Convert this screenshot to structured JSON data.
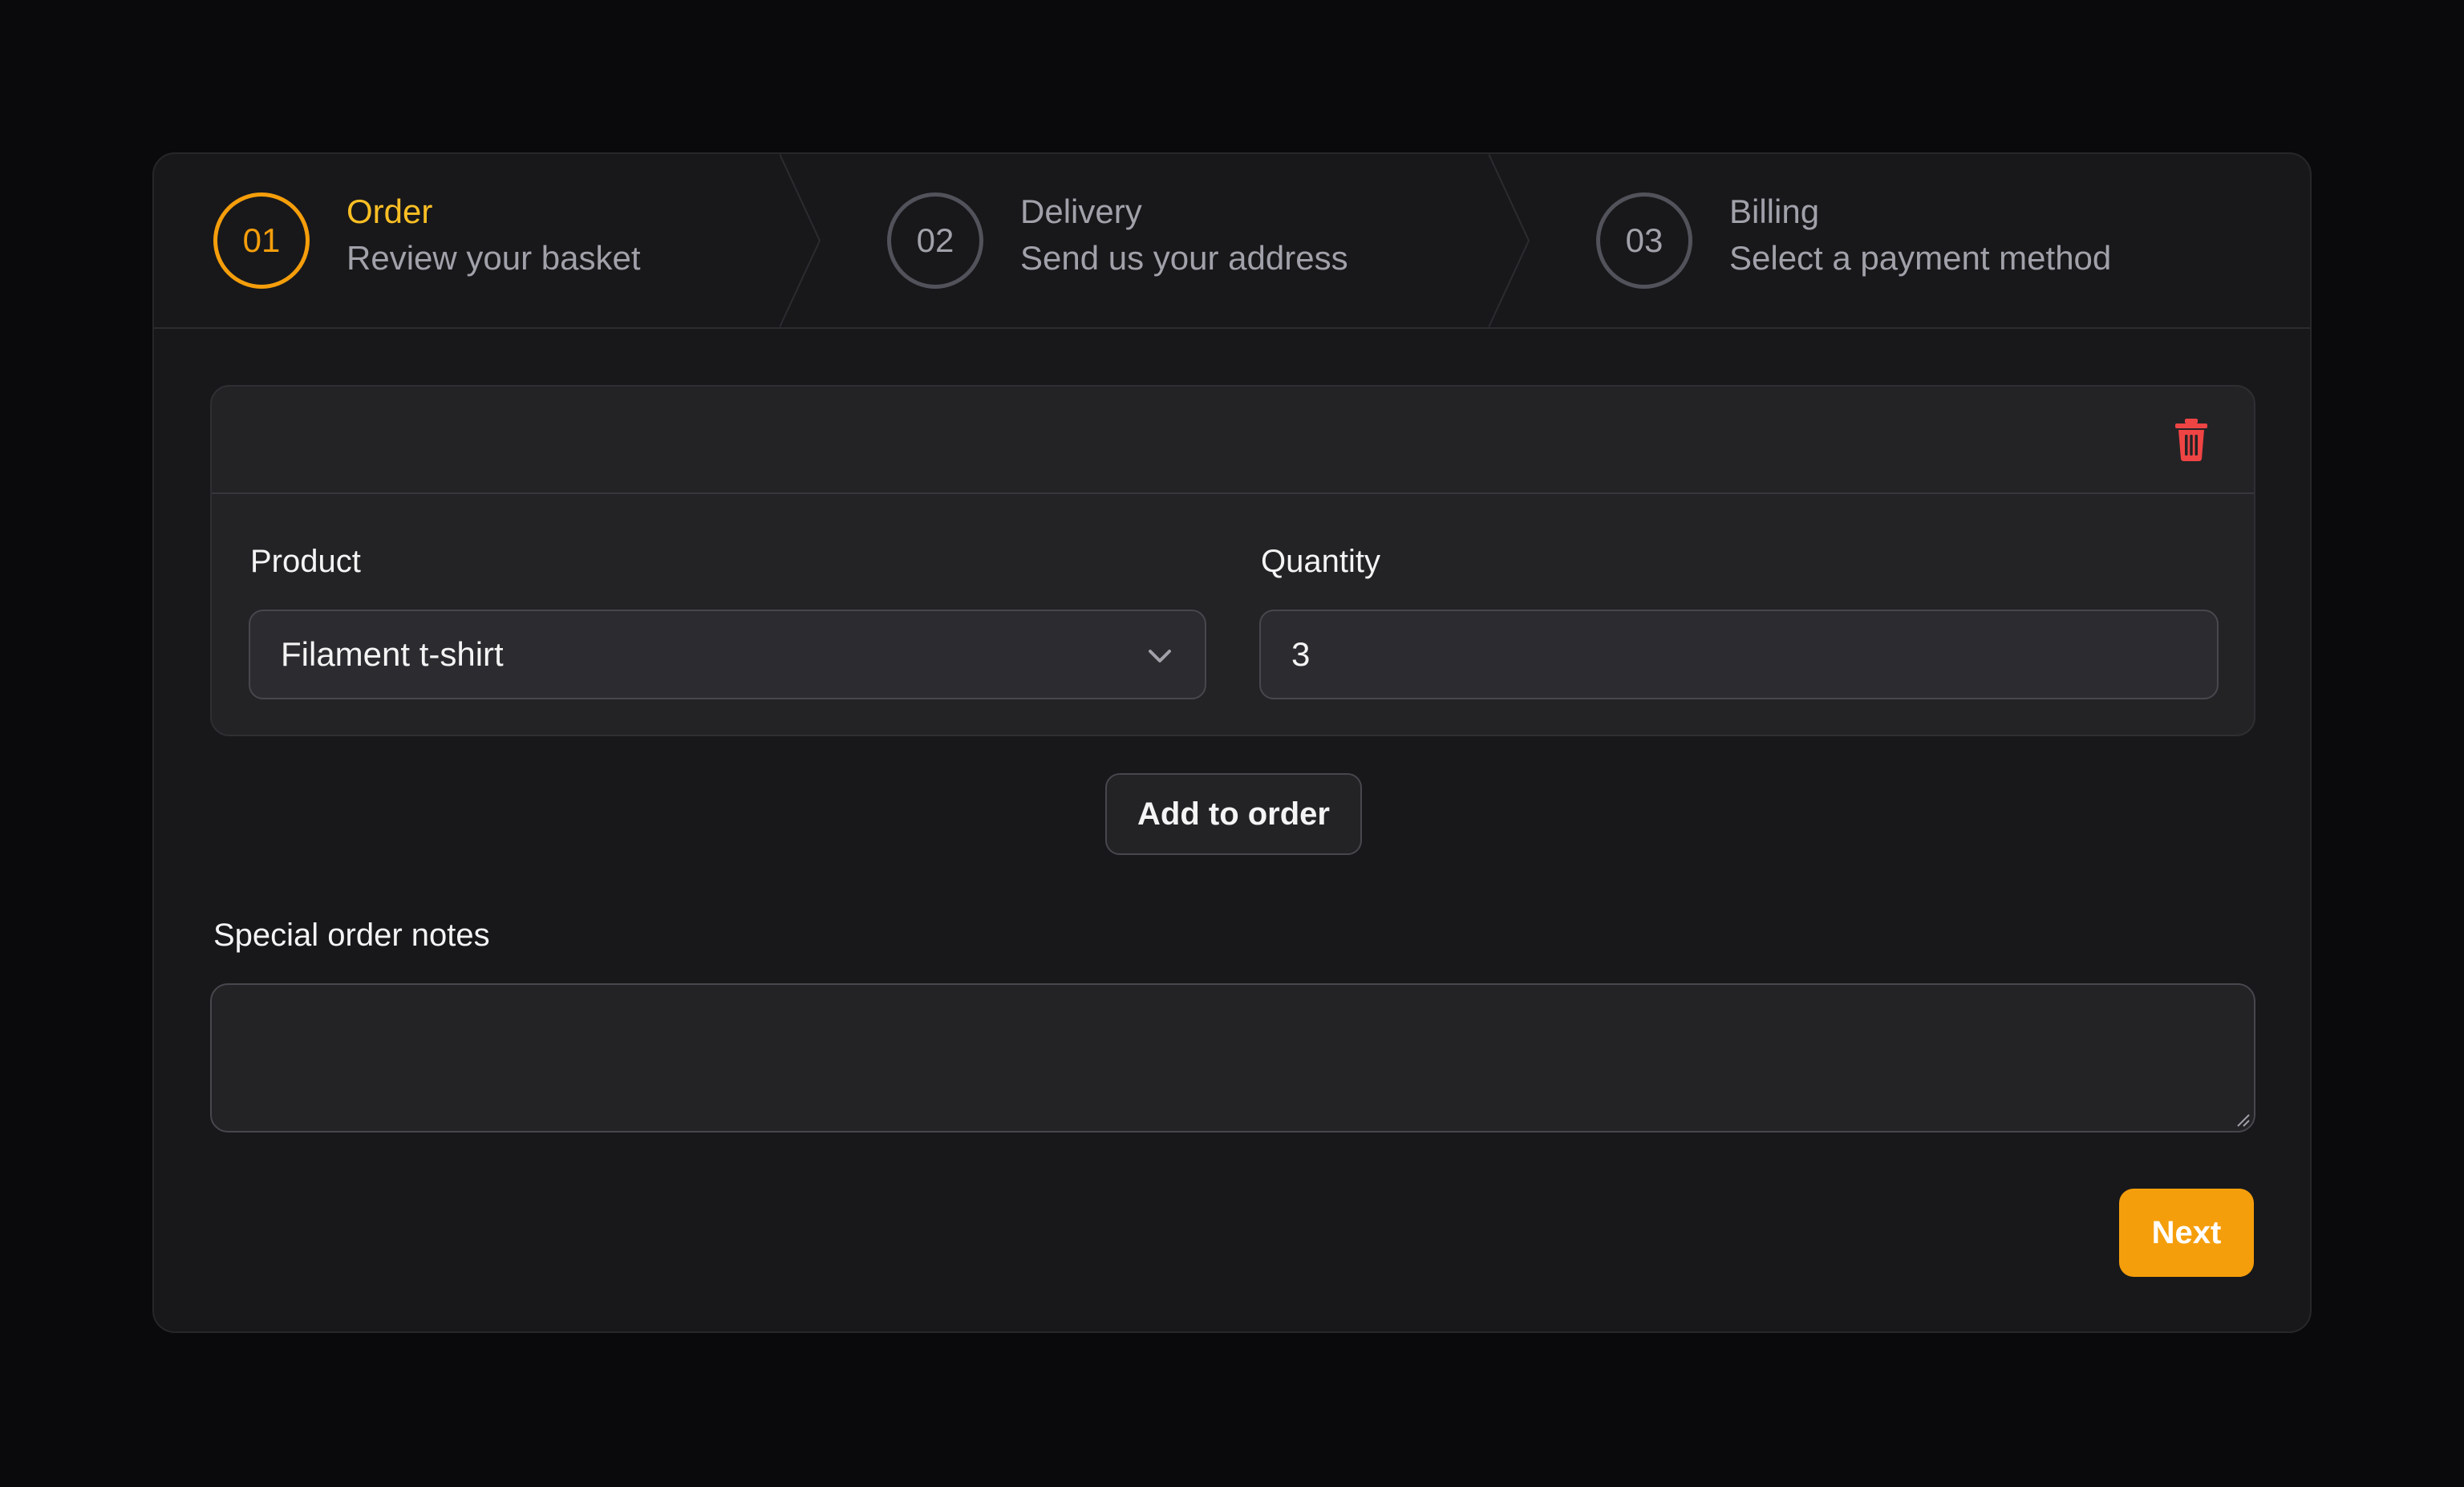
{
  "steps": [
    {
      "number": "01",
      "title": "Order",
      "description": "Review your basket",
      "active": true
    },
    {
      "number": "02",
      "title": "Delivery",
      "description": "Send us your address",
      "active": false
    },
    {
      "number": "03",
      "title": "Billing",
      "description": "Select a payment method",
      "active": false
    }
  ],
  "order_item": {
    "product_label": "Product",
    "product_value": "Filament t-shirt",
    "quantity_label": "Quantity",
    "quantity_value": "3",
    "delete_icon": "trash-icon"
  },
  "add_button_label": "Add to order",
  "notes": {
    "label": "Special order notes",
    "value": ""
  },
  "next_button_label": "Next",
  "colors": {
    "accent": "#f59e0b",
    "danger": "#ef4444",
    "background": "#0a0a0c",
    "card": "#18181b"
  }
}
